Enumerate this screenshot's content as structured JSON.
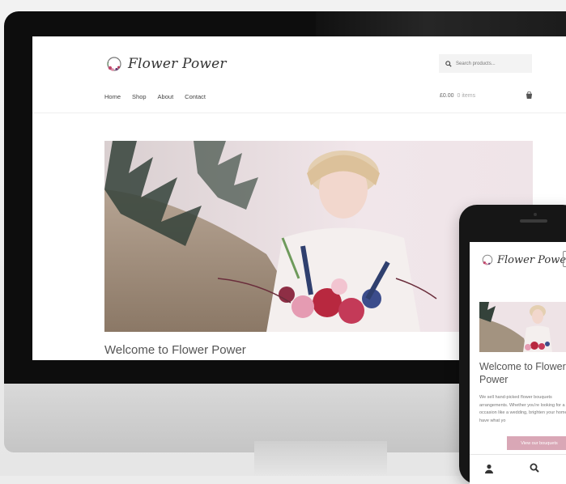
{
  "site": {
    "brand": "Flower Power",
    "search_placeholder": "Search products...",
    "nav": [
      "Home",
      "Shop",
      "About",
      "Contact"
    ],
    "cart_total": "£0.00",
    "cart_items": "0 items",
    "welcome": "Welcome to Flower Power"
  },
  "mobile": {
    "brand": "Flower Power",
    "welcome": "Welcome to Flower Power",
    "body": "We sell hand-picked flower bouquets arrangements. Whether you're looking for a special occasion like a wedding, brighten your home, we have what yo",
    "button": "View our bouquets"
  },
  "icons": {
    "search": "search-icon",
    "cart": "shopping-bag-icon",
    "account": "user-icon",
    "logo": "flower-wreath-icon"
  },
  "colors": {
    "accent": "#d9a7b6",
    "screen_bezel": "#0d0d0d"
  }
}
